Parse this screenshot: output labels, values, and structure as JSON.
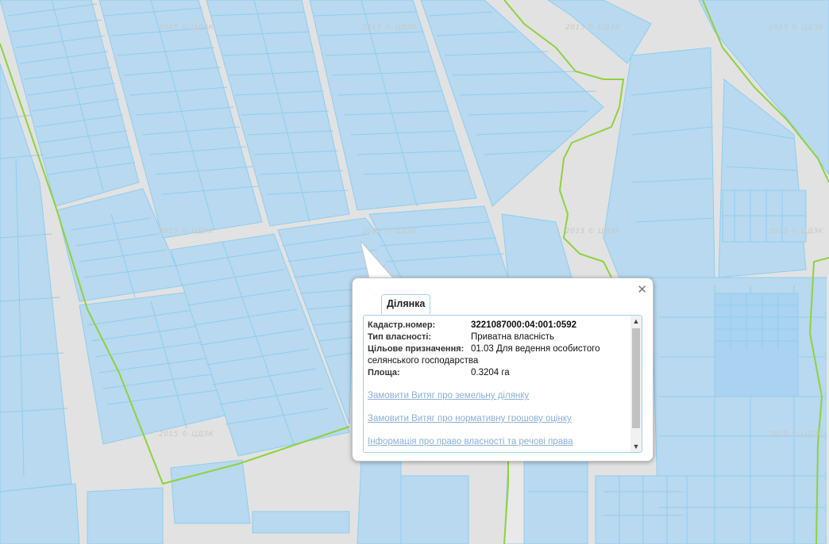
{
  "map": {
    "watermark": "2015 © ЦДЗК",
    "colors": {
      "background": "#e2e2e2",
      "parcel_fill": "#b8d9ef",
      "parcel_stroke": "#8fcdf0",
      "boundary": "#8fd23e"
    }
  },
  "popup": {
    "tab_label": "Ділянка",
    "close_icon": "close-icon",
    "fields": {
      "cadastral": {
        "label": "Кадастр.номер:",
        "value": "3221087000:04:001:0592"
      },
      "ownership": {
        "label": "Тип власності:",
        "value": "Приватна власність"
      },
      "purpose": {
        "label": "Цільове призначення:",
        "value": "01.03 Для ведення особистого",
        "value_cont": "селянського господарства"
      },
      "area": {
        "label": "Площа:",
        "value": "0.3204 га"
      }
    },
    "links": [
      "Замовити Витяг про земельну ділянку",
      "Замовити Витяг про нормативну грошову оцінку",
      "Інформація про право власності та речові права"
    ]
  }
}
